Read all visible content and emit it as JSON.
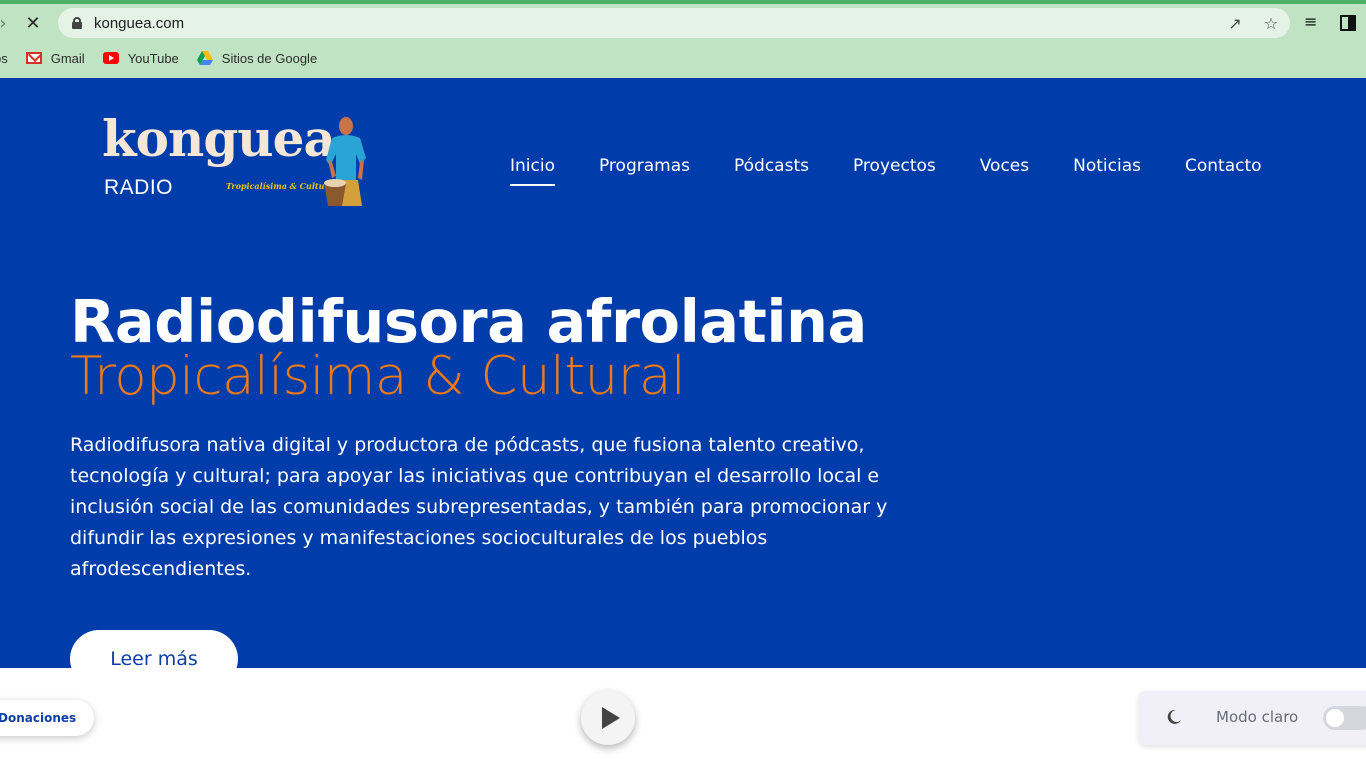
{
  "browser": {
    "url": "konguea.com",
    "bookmarks": [
      {
        "label": "ps",
        "icon": "apps-icon"
      },
      {
        "label": "Gmail",
        "icon": "gmail-icon"
      },
      {
        "label": "YouTube",
        "icon": "youtube-icon"
      },
      {
        "label": "Sitios de Google",
        "icon": "google-drive-icon"
      }
    ],
    "icons": {
      "back": "back-arrow-icon",
      "stop": "close-icon",
      "lock": "lock-icon",
      "share": "share-icon",
      "bookmark": "star-icon",
      "media": "media-queue-icon",
      "side_panel": "side-panel-icon"
    }
  },
  "site": {
    "logo": {
      "word": "konguea",
      "radio": "RADIO",
      "tagline": "Tropicalísima & Cultural"
    },
    "nav": [
      {
        "label": "Inicio",
        "active": true
      },
      {
        "label": "Programas",
        "active": false
      },
      {
        "label": "Pódcasts",
        "active": false
      },
      {
        "label": "Proyectos",
        "active": false
      },
      {
        "label": "Voces",
        "active": false
      },
      {
        "label": "Noticias",
        "active": false
      },
      {
        "label": "Contacto",
        "active": false
      }
    ],
    "hero": {
      "title": "Radiodifusora afrolatina",
      "subtitle": "Tropicalísima & Cultural",
      "description": "Radiodifusora nativa digital y productora de pódcasts, que fusiona talento creativo, tecnología y cultural; para apoyar las iniciativas que contribuyan el desarrollo local e inclusión social de las comunidades subrepresentadas, y también para promocionar y difundir las expresiones y manifestaciones socioculturales de los pueblos afrodescendientes.",
      "button": "Leer más"
    },
    "player": {
      "donate_label": "Donaciones",
      "mode_label": "Modo claro",
      "toggle_on": false
    },
    "colors": {
      "hero_bg": "#003daa",
      "accent_orange": "#f07a16",
      "chrome_bg": "#bfe3c3"
    }
  }
}
